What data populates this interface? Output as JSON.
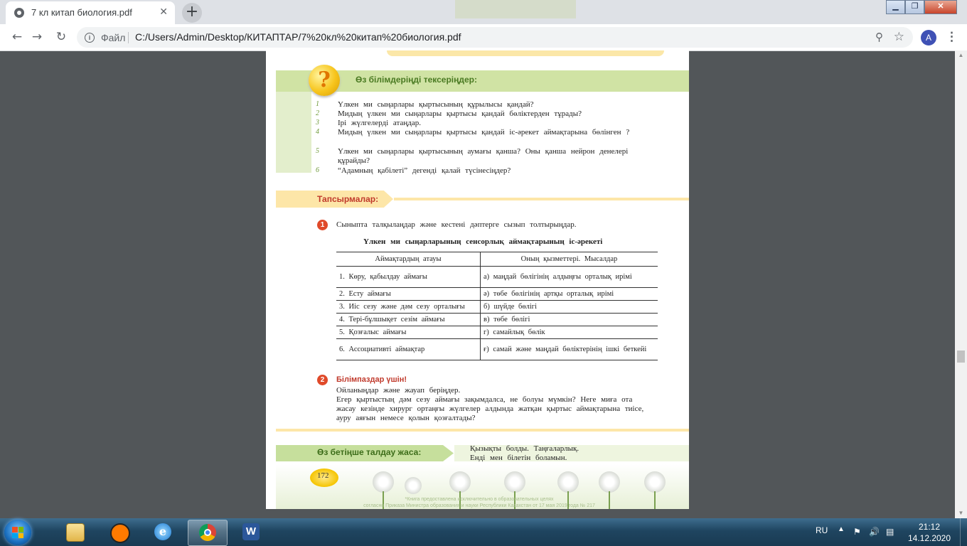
{
  "browser": {
    "tab_title": "7 кл китап биология.pdf",
    "new_tab_icon": "plus-icon",
    "address_scheme": "Файл",
    "address_url": "C:/Users/Admin/Desktop/КИТАПТАР/7%20кл%20китап%20биология.pdf",
    "avatar_letter": "A"
  },
  "page": {
    "check_title": "Өз білімдеріңді тексеріңдер:",
    "questions": [
      {
        "n": "1",
        "text": "Үлкен ми сыңарлары қыртысының құрылысы қандай?"
      },
      {
        "n": "2",
        "text": "Мидың үлкен ми сыңарлары қыртысы қандай бөліктерден тұрады?"
      },
      {
        "n": "3",
        "text": "Ірі жүлгелерді атаңдар."
      },
      {
        "n": "4",
        "text": "Мидың үлкен ми сыңарлары қыртысы қандай іс-әрекет аймақтарына бөлінген ?"
      },
      {
        "n": "5",
        "text": "Үлкен ми сыңарлары қыртысының аумағы қанша? Оны қанша нейрон денелері құрайды?"
      },
      {
        "n": "6",
        "text": "“Адамның қабілеті” дегенді қалай түсінесіңдер?"
      }
    ],
    "tasks_title": "Тапсырмалар:",
    "task1_num": "1",
    "task1_text": "Сыныпта талқылаңдар және кестені дәптерге сызып толтырыңдар.",
    "table_title": "Үлкен ми сыңарларының сенсорлық аймақтарының іс-әрекеті",
    "table_headers": [
      "Аймақтардың атауы",
      "Оның қызметтері. Мысалдар"
    ],
    "table_rows": [
      [
        "1. Көру, қабылдау аймағы",
        "а) маңдай бөлігінің алдыңғы орталық ирімі"
      ],
      [
        "2. Есту аймағы",
        "ә) төбе бөлігінің артқы орталық ирімі"
      ],
      [
        "3. Иіс сезу және дәм сезу орталығы",
        "б) шүйде бөлігі"
      ],
      [
        "4. Тері-бұлшықет сезім аймағы",
        "в) төбе бөлігі"
      ],
      [
        "5. Қозғалыс аймағы",
        "г) самайлық бөлік"
      ],
      [
        "6. Ассоциативті аймақтар",
        "ғ) самай және маңдай бөліктерінің ішкі беткейі"
      ]
    ],
    "task2_num": "2",
    "expert_title": "Білімпаздар үшін!",
    "expert_lines": [
      "Ойланыңдар және жауап беріңдер.",
      "Егер қыртыстың дәм сезу аймағы зақымдалса, не болуы мүмкін? Неге миға ота жасау кезінде хирург ортаңғы жүлгелер алдында жатқан қыртыс аймақтарына тиісе, ауру аяғын немесе қолын қозғалтады?"
    ],
    "self_title": "Өз бетіңше талдау жаса:",
    "self_lines": [
      "Қызықты болды. Таңғаларлық.",
      "Енді мен білетін боламын."
    ],
    "page_number": "172",
    "fine_print": [
      "*Книга предоставлена исключительно в образовательных целях",
      "согласно Приказа Министра образования и науки Республики Казахстан от 17 мая 2019 года № 217"
    ]
  },
  "taskbar": {
    "apps": [
      "file-explorer-icon",
      "avast-icon",
      "internet-explorer-icon",
      "chrome-icon",
      "word-icon"
    ],
    "language": "RU",
    "time": "21:12",
    "date": "14.12.2020"
  }
}
